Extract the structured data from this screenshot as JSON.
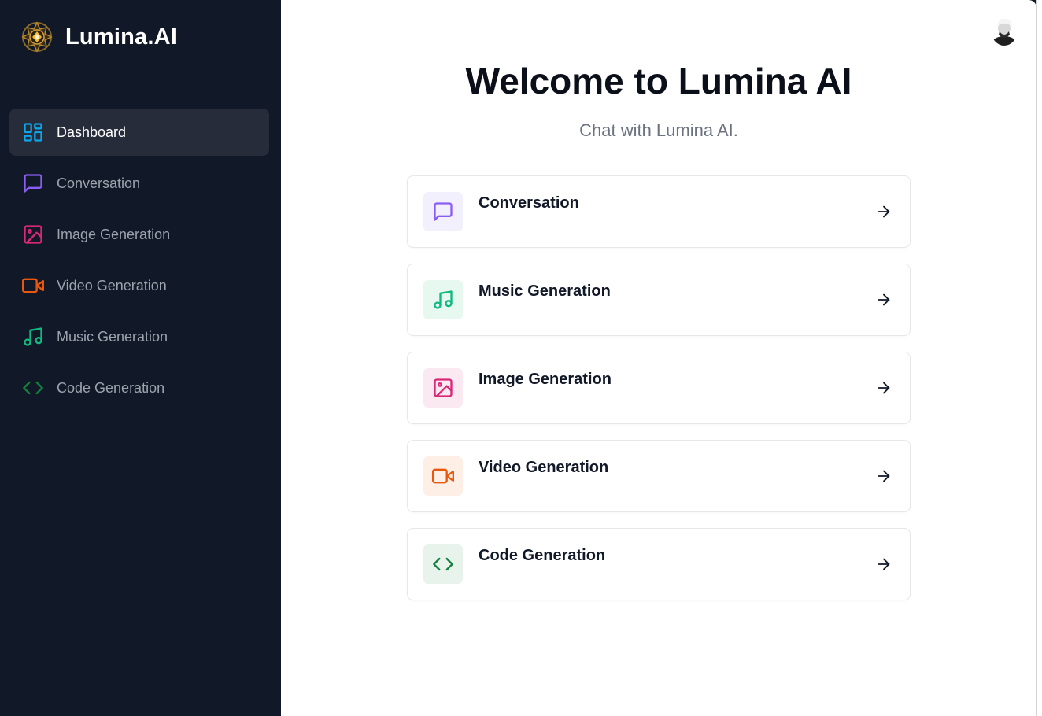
{
  "brand": {
    "name": "Lumina.AI"
  },
  "sidebar": {
    "items": [
      {
        "label": "Dashboard",
        "icon": "dashboard-icon",
        "color": "#0ea5e9",
        "active": true
      },
      {
        "label": "Conversation",
        "icon": "message-square-icon",
        "color": "#8b5cf6"
      },
      {
        "label": "Image Generation",
        "icon": "image-icon",
        "color": "#db2777"
      },
      {
        "label": "Video Generation",
        "icon": "video-icon",
        "color": "#ea580c"
      },
      {
        "label": "Music Generation",
        "icon": "music-icon",
        "color": "#10b981"
      },
      {
        "label": "Code Generation",
        "icon": "code-icon",
        "color": "#15803d"
      }
    ]
  },
  "main": {
    "title": "Welcome to Lumina AI",
    "subtitle": "Chat with Lumina AI.",
    "cards": [
      {
        "label": "Conversation",
        "icon": "message-square-icon",
        "color": "#8b5cf6",
        "bg": "#f3f0fe"
      },
      {
        "label": "Music Generation",
        "icon": "music-icon",
        "color": "#10b981",
        "bg": "#e7f8f1"
      },
      {
        "label": "Image Generation",
        "icon": "image-icon",
        "color": "#db2777",
        "bg": "#fbe9f1"
      },
      {
        "label": "Video Generation",
        "icon": "video-icon",
        "color": "#ea580c",
        "bg": "#fdeee6"
      },
      {
        "label": "Code Generation",
        "icon": "code-icon",
        "color": "#15803d",
        "bg": "#e8f3ec"
      }
    ]
  }
}
